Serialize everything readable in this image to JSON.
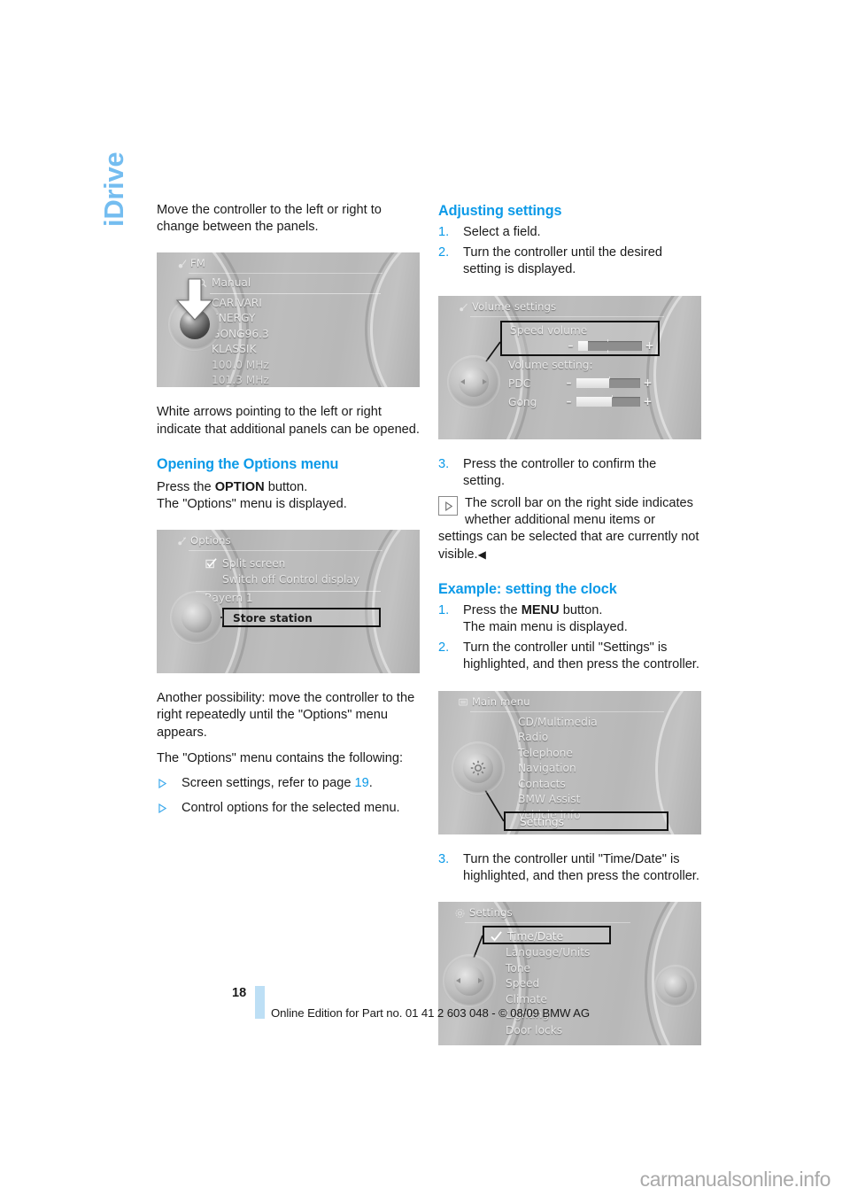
{
  "chapter_tab": "iDrive",
  "left_column": {
    "intro_paragraph": "Move the controller to the left or right to change between the panels.",
    "after_fm_paragraph": "White arrows pointing to the left or right indicate that additional panels can be opened.",
    "options_heading": "Opening the Options menu",
    "press_option_prefix": "Press the ",
    "press_option_bold": "OPTION",
    "press_option_suffix": " button.",
    "options_displayed": "The \"Options\" menu is displayed.",
    "another_possibility": "Another possibility: move the controller to the right repeatedly until the \"Options\" menu appears.",
    "contains_following": "The \"Options\" menu contains the following:",
    "bullets": [
      {
        "icon": "triangle-bullet-icon",
        "text_before": "Screen settings, refer to page ",
        "page_ref": "19",
        "text_after": "."
      },
      {
        "icon": "triangle-bullet-icon",
        "text_before": "Control options for the selected menu.",
        "page_ref": "",
        "text_after": ""
      }
    ]
  },
  "right_column": {
    "adjusting_heading": "Adjusting settings",
    "adjusting_steps": [
      {
        "num": "1.",
        "text": "Select a field."
      },
      {
        "num": "2.",
        "text": "Turn the controller until the desired setting is displayed."
      }
    ],
    "step3": {
      "num": "3.",
      "text": "Press the controller to confirm the setting."
    },
    "note": {
      "icon": "play-triangle-box-icon",
      "text": "The scroll bar on the right side indicates whether additional menu items or settings can be selected that are currently not visible.",
      "end_mark": "◀"
    },
    "example_heading": "Example: setting the clock",
    "example_steps": [
      {
        "num": "1.",
        "text_before": "Press the ",
        "bold": "MENU",
        "text_after": " button.",
        "second_line": "The main menu is displayed."
      },
      {
        "num": "2.",
        "text_before": "Turn the controller until \"Settings\" is highlighted, and then press the controller.",
        "bold": "",
        "text_after": "",
        "second_line": ""
      }
    ],
    "step3_clock": {
      "num": "3.",
      "text": "Turn the controller until \"Time/Date\" is highlighted, and then press the controller."
    }
  },
  "screens": {
    "fm": {
      "title": "FM",
      "title_icon": "radio-antenna-icon",
      "search_icon": "magnifier-icon",
      "search_label": "Manual",
      "items": [
        "CARIVARI",
        "ENERGY",
        "GONG96.3",
        "KLASSIK",
        "100.0 MHz",
        "101.3 MHz"
      ],
      "arrow_icon": "down-arrow-icon",
      "controller_icon": "controller-knob-icon"
    },
    "options": {
      "title": "Options",
      "title_icon": "options-icon",
      "checkbox_icon": "checkbox-checked-icon",
      "items": [
        "Split screen",
        "Switch off Control display"
      ],
      "group_label": "Bayern 1",
      "selected_item": "Store station",
      "controller_icon": "controller-knob-icon"
    },
    "volume": {
      "title": "Volume settings",
      "title_icon": "speaker-icon",
      "selected_field_label": "Speed volume",
      "speed_slider": {
        "minus": "–",
        "plus": "+",
        "value": 8
      },
      "section_label": "Volume setting:",
      "rows": [
        {
          "label": "PDC",
          "minus": "–",
          "plus": "+",
          "value": 52
        },
        {
          "label": "Gong",
          "minus": "–",
          "plus": "+",
          "value": 56
        }
      ],
      "controller_icon": "controller-knob-icon"
    },
    "main_menu": {
      "title": "Main menu",
      "title_icon": "display-icon",
      "items": [
        "CD/Multimedia",
        "Radio",
        "Telephone",
        "Navigation",
        "Contacts",
        "BMW Assist",
        "Vehicle Info"
      ],
      "selected_item": "Settings",
      "controller_icon": "menu-button-icon"
    },
    "settings": {
      "title": "Settings",
      "title_icon": "gear-icon",
      "check_icon": "checkmark-icon",
      "selected_item": "Time/Date",
      "items": [
        "Language/Units",
        "Tone",
        "Speed",
        "Climate",
        "Lighting",
        "Door locks"
      ],
      "controller_icon": "controller-knob-icon"
    }
  },
  "footer": {
    "page_number": "18",
    "text": "Online Edition for Part no. 01 41 2 603 048 - © 08/09 BMW AG"
  },
  "watermark": "carmanualsonline.info",
  "colors": {
    "accent_blue": "#0c9ae8",
    "tab_blue": "#74bdf0",
    "footer_bar": "#bddff5"
  }
}
